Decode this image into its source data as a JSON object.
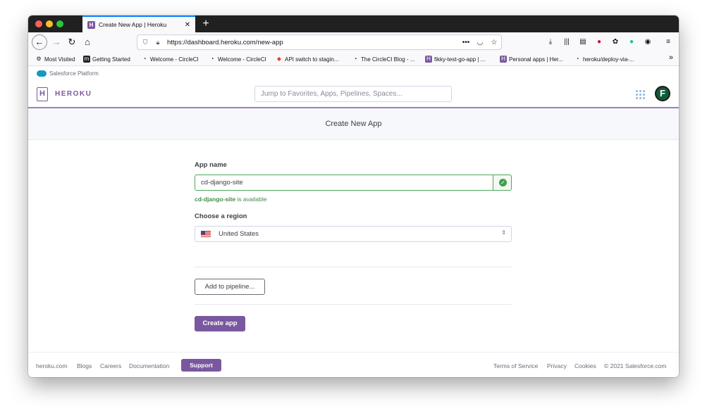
{
  "browser": {
    "tab_title": "Create New App | Heroku",
    "tab_favicon": "H",
    "close_glyph": "✕",
    "newtab_glyph": "+",
    "url": "https://dashboard.heroku.com/new-app",
    "bookmarks": [
      {
        "label": "Most Visited",
        "icon": "gear-icon"
      },
      {
        "label": "Getting Started",
        "icon": "m-icon"
      },
      {
        "label": "Welcome - CircleCI",
        "icon": "circleci-icon"
      },
      {
        "label": "Welcome - CircleCI",
        "icon": "circleci-icon"
      },
      {
        "label": "API switch to stagin...",
        "icon": "gitlab-icon"
      },
      {
        "label": "The CircleCI Blog - ...",
        "icon": "circleci-icon"
      },
      {
        "label": "fikky-test-go-app | ...",
        "icon": "heroku-icon"
      },
      {
        "label": "Personal apps | Her...",
        "icon": "heroku-icon"
      },
      {
        "label": "heroku/deploy-via-...",
        "icon": "circleci-icon"
      }
    ],
    "more_glyph": "»"
  },
  "salesforce": {
    "label": "Salesforce Platform"
  },
  "heroku": {
    "brand": "HEROKU",
    "logo_glyph": "H",
    "search_placeholder": "Jump to Favorites, Apps, Pipelines, Spaces...",
    "avatar_initial": "F"
  },
  "page": {
    "title": "Create New App",
    "app_name_label": "App name",
    "app_name_value": "cd-django-site",
    "available_name": "cd-django-site",
    "available_suffix": " is available",
    "check_glyph": "✓",
    "region_label": "Choose a region",
    "region_value": "United States",
    "region_chevron": "⇕",
    "pipeline_button": "Add to pipeline...",
    "create_button": "Create app"
  },
  "footer": {
    "links_left": [
      "heroku.com",
      "Blogs",
      "Careers",
      "Documentation"
    ],
    "support": "Support",
    "links_right": [
      "Terms of Service",
      "Privacy",
      "Cookies",
      "© 2021 Salesforce.com"
    ]
  },
  "colors": {
    "heroku_purple": "#79589f",
    "success_green": "#3ea04c",
    "firefox_accent": "#0a84ff"
  }
}
